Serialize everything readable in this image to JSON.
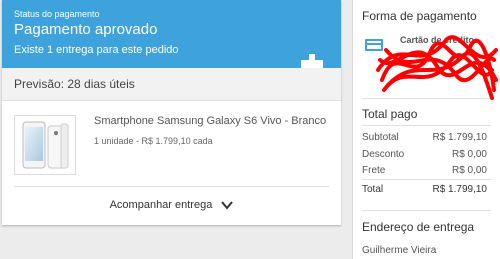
{
  "order": {
    "status_label": "Status do pagamento",
    "status_title": "Pagamento aprovado",
    "status_sub": "Existe 1 entrega para este pedido",
    "forecast": "Previsão: 28 dias úteis",
    "product_name": "Smartphone Samsung Galaxy S6 Vivo - Branco",
    "product_meta": "1 unidade - R$ 1.799,10 cada",
    "track_label": "Acompanhar entrega"
  },
  "payment": {
    "title": "Forma de pagamento",
    "method": "Cartão de crédito"
  },
  "totals": {
    "title": "Total pago",
    "rows": [
      {
        "label": "Subtotal",
        "value": "R$ 1.799,10"
      },
      {
        "label": "Desconto",
        "value": "R$ 0,00"
      },
      {
        "label": "Frete",
        "value": "R$ 0,00"
      }
    ],
    "total_label": "Total",
    "total_value": "R$ 1.799,10"
  },
  "address": {
    "title": "Endereço de entrega",
    "name": "Guilherme Vieira"
  },
  "colors": {
    "accent": "#3ea2dc",
    "redaction": "#ff0000"
  }
}
